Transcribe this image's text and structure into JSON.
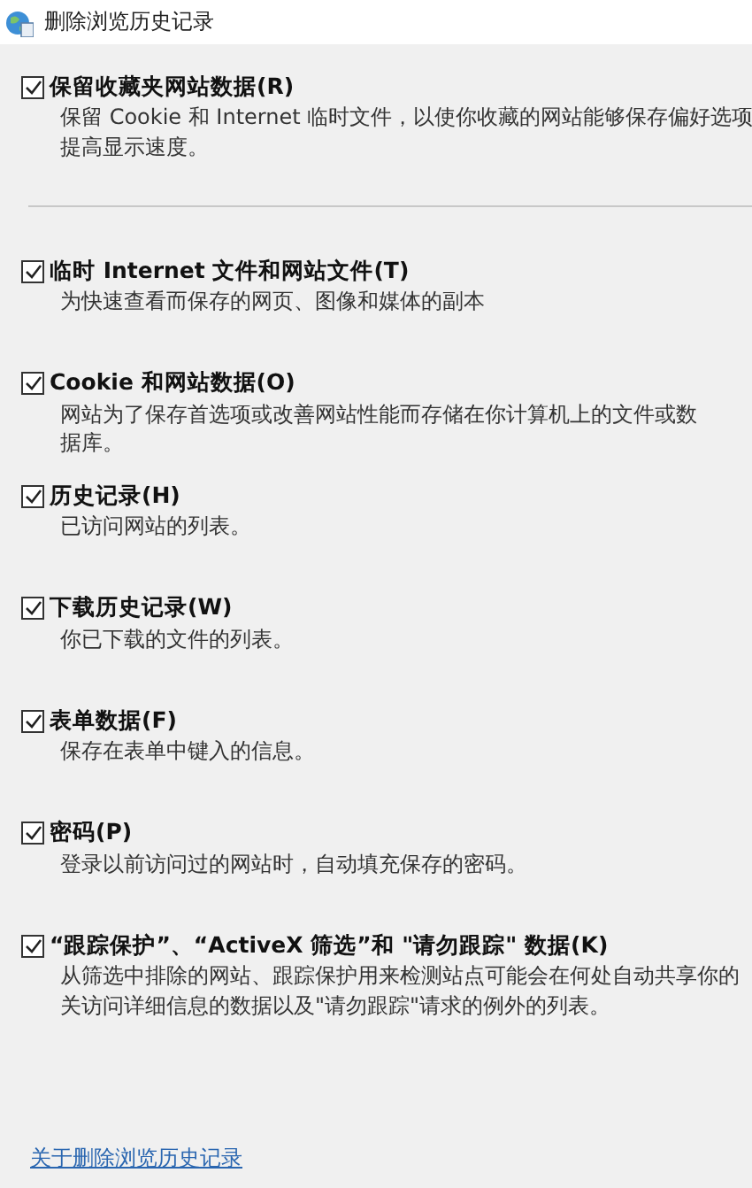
{
  "window": {
    "title": "删除浏览历史记录"
  },
  "options": [
    {
      "label": "保留收藏夹网站数据(R)",
      "checked": true,
      "description": [
        "保留 Cookie 和 Internet 临时文件，以使你收藏的网站能够保存偏好选项",
        "提高显示速度。"
      ]
    },
    {
      "label": "临时 Internet 文件和网站文件(T)",
      "checked": true,
      "description": [
        "为快速查看而保存的网页、图像和媒体的副本"
      ]
    },
    {
      "label": "Cookie 和网站数据(O)",
      "checked": true,
      "description": [
        "网站为了保存首选项或改善网站性能而存储在你计算机上的文件或数",
        "据库。"
      ]
    },
    {
      "label": "历史记录(H)",
      "checked": true,
      "description": [
        "已访问网站的列表。"
      ]
    },
    {
      "label": "下载历史记录(W)",
      "checked": true,
      "description": [
        "你已下载的文件的列表。"
      ]
    },
    {
      "label": "表单数据(F)",
      "checked": true,
      "description": [
        "保存在表单中键入的信息。"
      ]
    },
    {
      "label": "密码(P)",
      "checked": true,
      "description": [
        "登录以前访问过的网站时，自动填充保存的密码。"
      ]
    },
    {
      "label": "“跟踪保护”、“ActiveX 筛选”和 \"请勿跟踪\" 数据(K)",
      "checked": true,
      "description": [
        "从筛选中排除的网站、跟踪保护用来检测站点可能会在何处自动共享你的",
        "关访问详细信息的数据以及\"请勿跟踪\"请求的例外的列表。"
      ]
    }
  ],
  "link": "关于删除浏览历史记录"
}
